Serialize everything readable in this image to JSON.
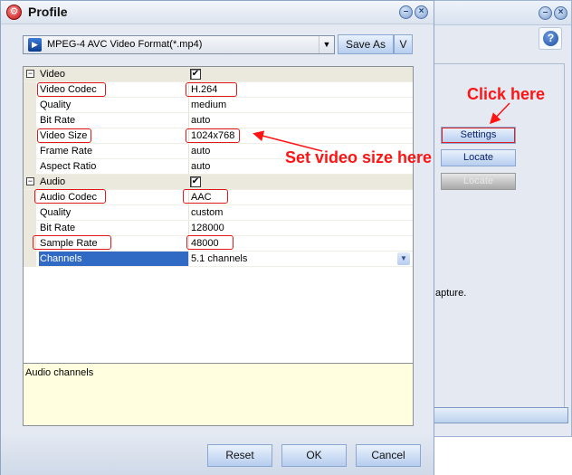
{
  "background_window": {
    "help_icon": "question-mark",
    "buttons": [
      {
        "label": "Settings",
        "highlighted": true,
        "enabled": true
      },
      {
        "label": "Locate",
        "enabled": true
      },
      {
        "label": "Locate",
        "enabled": false
      }
    ],
    "partial_text": "apture."
  },
  "dialog": {
    "title": "Profile",
    "format": {
      "selected": "MPEG-4 AVC Video Format(*.mp4)"
    },
    "save_as_label": "Save As",
    "v_label": "V",
    "properties": {
      "video": {
        "label": "Video",
        "checked": true,
        "toggle": "⊟",
        "items": [
          {
            "label": "Video Codec",
            "value": "H.264",
            "highlighted": true
          },
          {
            "label": "Quality",
            "value": "medium"
          },
          {
            "label": "Bit Rate",
            "value": "auto"
          },
          {
            "label": "Video Size",
            "value": "1024x768",
            "highlighted": true
          },
          {
            "label": "Frame Rate",
            "value": "auto"
          },
          {
            "label": "Aspect Ratio",
            "value": "auto"
          }
        ]
      },
      "audio": {
        "label": "Audio",
        "checked": true,
        "toggle": "⊟",
        "items": [
          {
            "label": "Audio Codec",
            "value": "AAC",
            "highlighted": true
          },
          {
            "label": "Quality",
            "value": "custom"
          },
          {
            "label": "Bit Rate",
            "value": "128000"
          },
          {
            "label": "Sample Rate",
            "value": "48000",
            "highlighted": true
          },
          {
            "label": "Channels",
            "value": "5.1 channels",
            "selected": true
          }
        ]
      }
    },
    "description": "Audio channels",
    "buttons": {
      "reset": "Reset",
      "ok": "OK",
      "cancel": "Cancel"
    }
  },
  "annotations": {
    "click_here": "Click here",
    "set_video_size": "Set video size here",
    "color": "#ff1414"
  }
}
